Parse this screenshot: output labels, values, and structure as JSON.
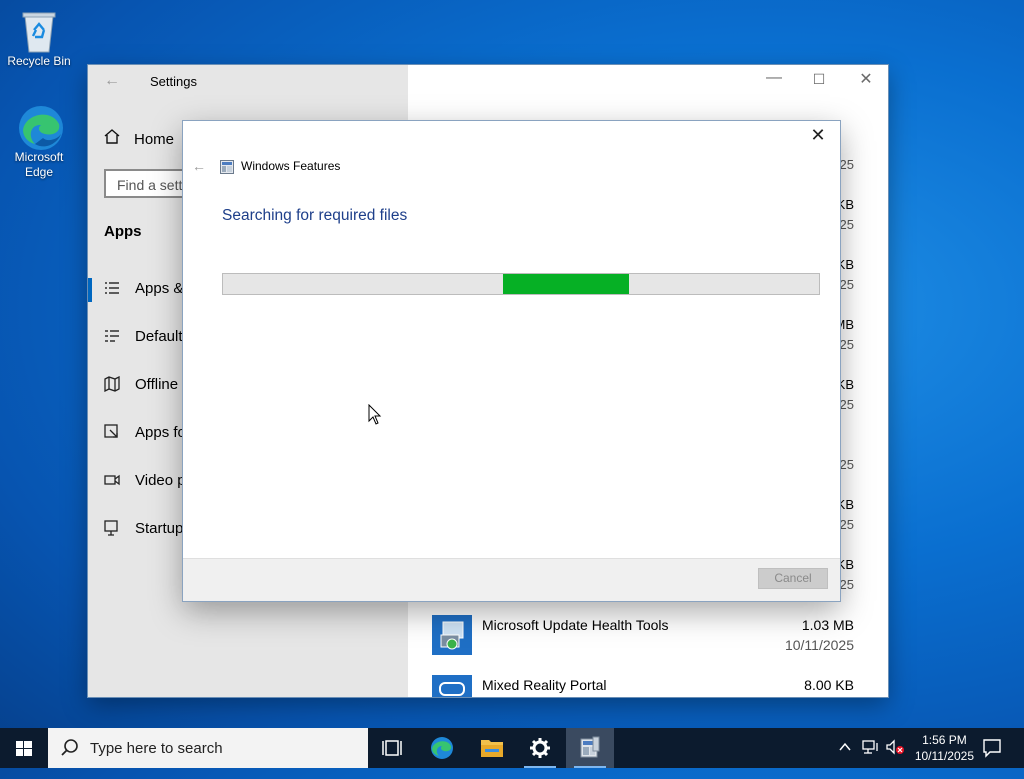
{
  "desktop": {
    "icons": [
      {
        "label": "Recycle Bin",
        "icon": "recycle-bin-icon"
      },
      {
        "label": "Microsoft Edge",
        "icon": "edge-icon"
      }
    ]
  },
  "settings": {
    "title": "Settings",
    "home_label": "Home",
    "search_placeholder": "Find a setti",
    "section_title": "Apps",
    "nav": [
      {
        "label": "Apps &",
        "icon": "apps-features-icon",
        "active": true
      },
      {
        "label": "Default",
        "icon": "default-apps-icon"
      },
      {
        "label": "Offline ",
        "icon": "offline-maps-icon"
      },
      {
        "label": "Apps fo",
        "icon": "apps-for-websites-icon"
      },
      {
        "label": "Video p",
        "icon": "video-playback-icon"
      },
      {
        "label": "Startup",
        "icon": "startup-icon"
      }
    ],
    "partial_list": [
      {
        "date": "25"
      },
      {
        "size": "KB",
        "date": "25"
      },
      {
        "size": "KB",
        "date": "25"
      },
      {
        "size": "MB",
        "date": "25"
      },
      {
        "size": "KB",
        "date": "25"
      },
      {
        "date": "25"
      },
      {
        "size": "KB",
        "date": "25"
      },
      {
        "size": "KB",
        "date": "25"
      }
    ],
    "apps": [
      {
        "name": "Microsoft Update Health Tools",
        "size": "1.03 MB",
        "date": "10/11/2025",
        "icon": "installer-icon"
      },
      {
        "name": "Mixed Reality Portal",
        "size": "8.00 KB",
        "icon": "mixed-reality-icon"
      }
    ]
  },
  "dialog": {
    "title": "Windows Features",
    "status": "Searching for required files",
    "progress_start": 0.469,
    "progress_end": 0.682,
    "cancel_label": "Cancel",
    "accent": "#06b025"
  },
  "taskbar": {
    "search_placeholder": "Type here to search",
    "time": "1:56 PM",
    "date": "10/11/2025"
  }
}
